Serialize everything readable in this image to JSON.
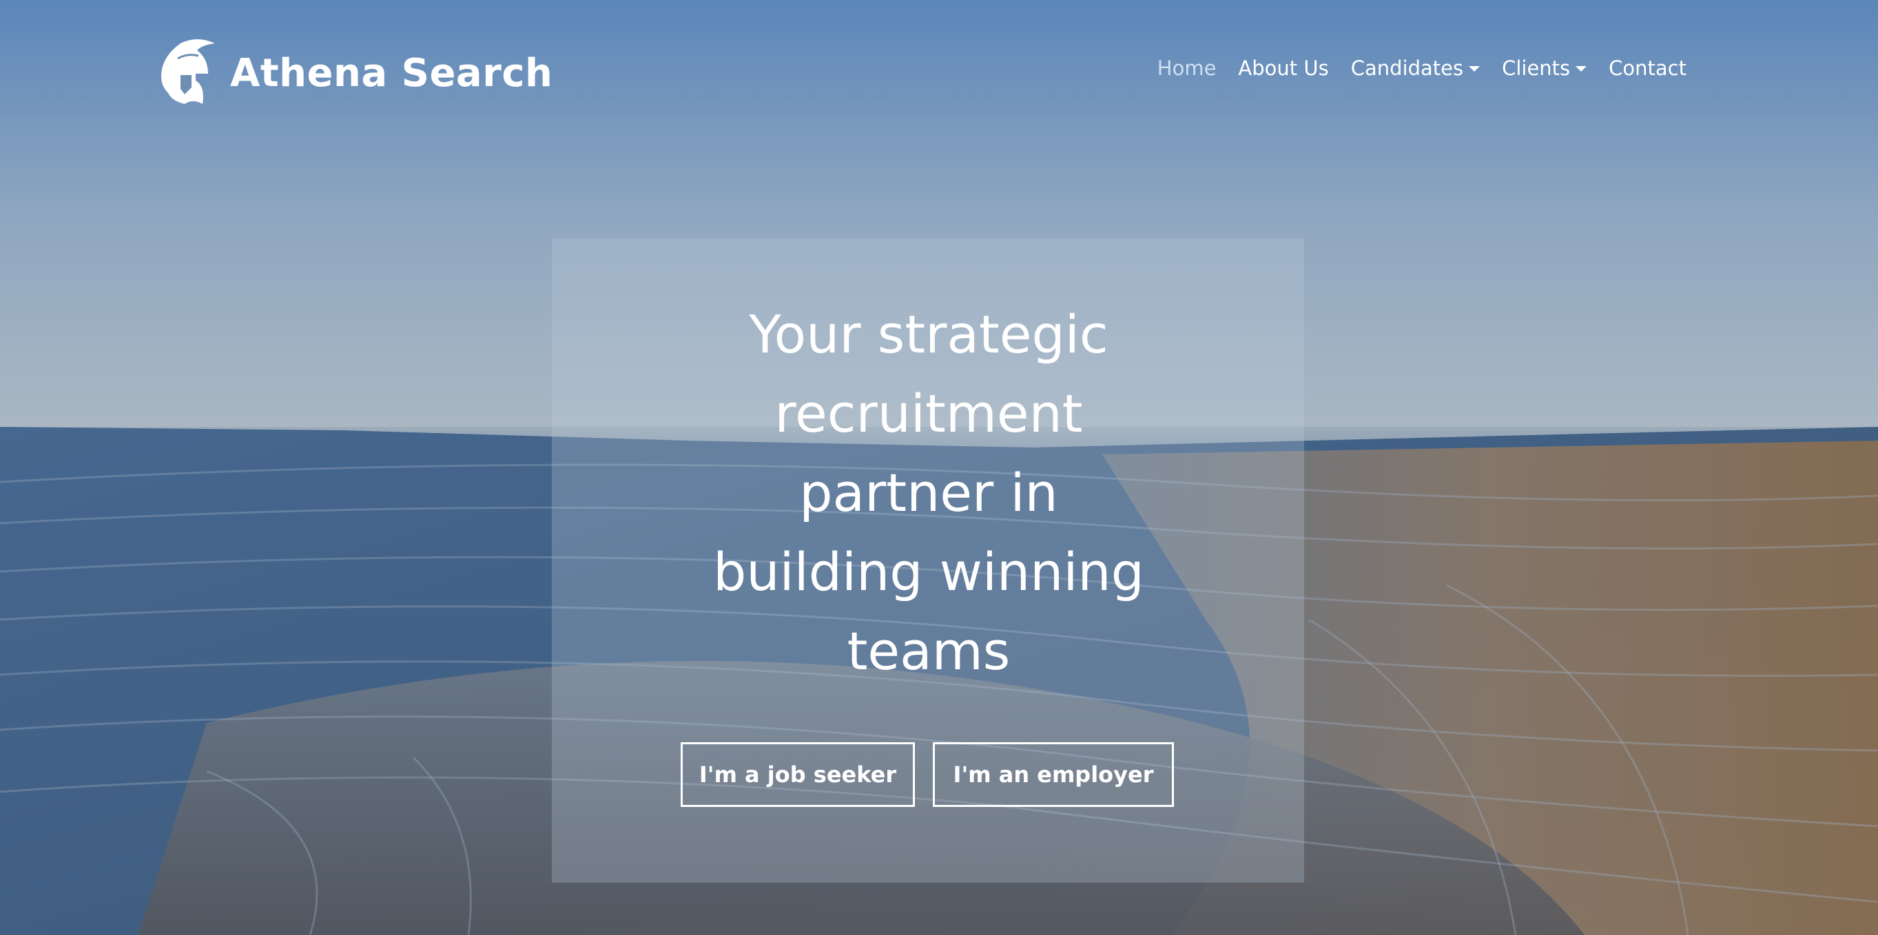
{
  "brand": {
    "name": "Athena Search",
    "logo_icon": "spartan-helmet-icon"
  },
  "nav": {
    "items": [
      {
        "label": "Home",
        "active": true,
        "dropdown": false
      },
      {
        "label": "About Us",
        "active": false,
        "dropdown": false
      },
      {
        "label": "Candidates",
        "active": false,
        "dropdown": true
      },
      {
        "label": "Clients",
        "active": false,
        "dropdown": true
      },
      {
        "label": "Contact",
        "active": false,
        "dropdown": false
      }
    ]
  },
  "hero": {
    "title": "Your strategic recruitment partner in building winning teams",
    "job_seeker_label": "I'm a job seeker",
    "employer_label": "I'm an employer",
    "background_image": "open-pit-mine-aerial-photo"
  },
  "colors": {
    "text": "#ffffff",
    "active_nav": "#cfe0f3",
    "sky": "#5a85b8"
  }
}
